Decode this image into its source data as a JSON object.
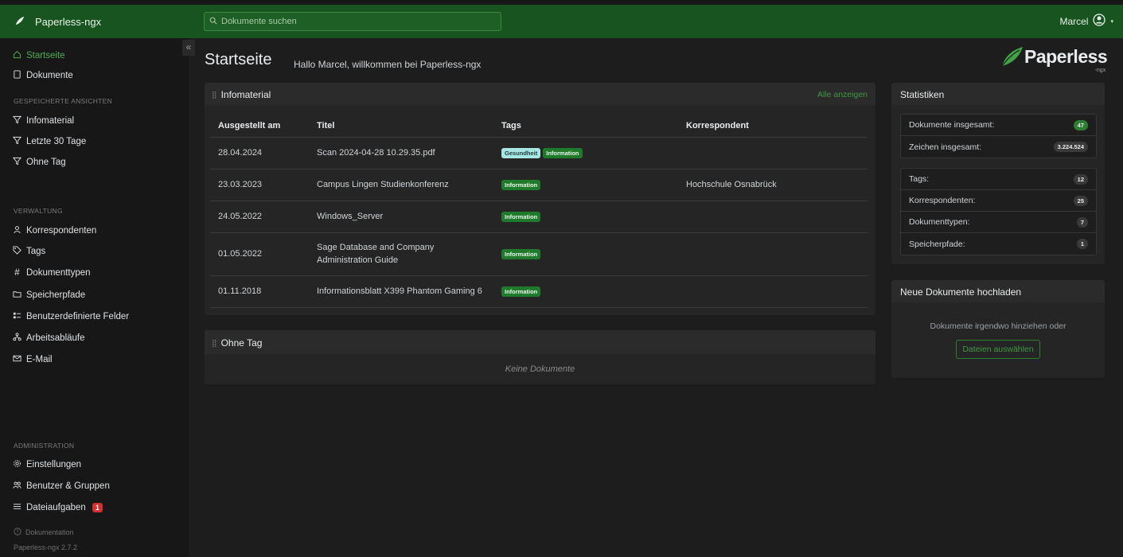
{
  "app": {
    "name": "Paperless-ngx",
    "logo_word": "Paperless",
    "logo_sub": "-ngx"
  },
  "search": {
    "placeholder": "Dokumente suchen"
  },
  "user": {
    "name": "Marcel"
  },
  "sidebar": {
    "collapse_label": "«",
    "items": [
      {
        "label": "Startseite",
        "icon": "house-icon"
      },
      {
        "label": "Dokumente",
        "icon": "document-icon"
      }
    ],
    "saved_views_header": "GESPEICHERTE ANSICHTEN",
    "saved_views": [
      "Infomaterial",
      "Letzte 30 Tage",
      "Ohne Tag"
    ],
    "management_header": "VERWALTUNG",
    "management": [
      {
        "label": "Korrespondenten",
        "icon": "person-icon"
      },
      {
        "label": "Tags",
        "icon": "tag-icon"
      },
      {
        "label": "Dokumenttypen",
        "icon": "hash-icon"
      },
      {
        "label": "Speicherpfade",
        "icon": "folder-icon"
      },
      {
        "label": "Benutzerdefinierte Felder",
        "icon": "fields-icon"
      },
      {
        "label": "Arbeitsabläufe",
        "icon": "workflow-icon"
      },
      {
        "label": "E-Mail",
        "icon": "mail-icon"
      }
    ],
    "admin_header": "ADMINISTRATION",
    "admin": [
      {
        "label": "Einstellungen",
        "icon": "gear-icon"
      },
      {
        "label": "Benutzer & Gruppen",
        "icon": "people-icon"
      },
      {
        "label": "Dateiaufgaben",
        "icon": "list-icon",
        "badge": "1"
      }
    ],
    "docs_link": "Dokumentation",
    "version": "Paperless-ngx 2.7.2"
  },
  "page": {
    "title": "Startseite",
    "subtitle": "Hallo Marcel, willkommen bei Paperless-ngx"
  },
  "infomaterial": {
    "title": "Infomaterial",
    "link": "Alle anzeigen",
    "columns": [
      "Ausgestellt am",
      "Titel",
      "Tags",
      "Korrespondent"
    ],
    "rows": [
      {
        "date": "28.04.2024",
        "title": "Scan 2024-04-28 10.29.35.pdf",
        "tags": [
          "Gesundheit",
          "Information"
        ],
        "correspondent": ""
      },
      {
        "date": "23.03.2023",
        "title": "Campus Lingen Studienkonferenz",
        "tags": [
          "Information"
        ],
        "correspondent": "Hochschule Osnabrück"
      },
      {
        "date": "24.05.2022",
        "title": "Windows_Server",
        "tags": [
          "Information"
        ],
        "correspondent": ""
      },
      {
        "date": "01.05.2022",
        "title": "Sage Database and Company Administration Guide",
        "tags": [
          "Information"
        ],
        "correspondent": ""
      },
      {
        "date": "01.11.2018",
        "title": "Informationsblatt X399 Phantom Gaming 6",
        "tags": [
          "Information"
        ],
        "correspondent": ""
      }
    ]
  },
  "ohne_tag": {
    "title": "Ohne Tag",
    "empty": "Keine Dokumente"
  },
  "stats": {
    "title": "Statistiken",
    "group1": [
      {
        "label": "Dokumente insgesamt:",
        "value": "47",
        "highlight": true
      },
      {
        "label": "Zeichen insgesamt:",
        "value": "3.224.524",
        "highlight": false
      }
    ],
    "group2": [
      {
        "label": "Tags:",
        "value": "12"
      },
      {
        "label": "Korrespondenten:",
        "value": "25"
      },
      {
        "label": "Dokumenttypen:",
        "value": "7"
      },
      {
        "label": "Speicherpfade:",
        "value": "1"
      }
    ]
  },
  "upload": {
    "title": "Neue Dokumente hochladen",
    "text": "Dokumente irgendwo hinziehen oder",
    "button": "Dateien auswählen"
  },
  "colors": {
    "topbar": "#17541f",
    "accent": "#4caf50",
    "tag_info": "#1f7a2c",
    "tag_health": "#a8e6e4",
    "badge_red": "#d32f2f"
  }
}
